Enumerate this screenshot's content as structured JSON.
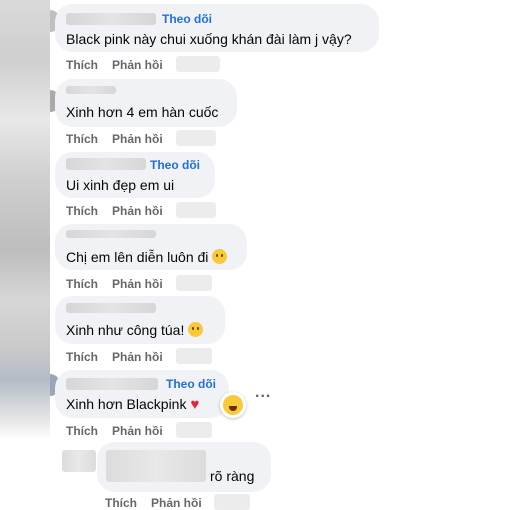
{
  "actions": {
    "like": "Thích",
    "reply": "Phản hồi"
  },
  "follow_label": "Theo dõi",
  "comments": [
    {
      "text": "Black pink này chui xuống khán đài làm j vậy?",
      "follow": true
    },
    {
      "text": "Xinh hơn 4 em hàn cuốc",
      "follow": false
    },
    {
      "text": "Ui xinh đẹp em ui",
      "follow": true
    },
    {
      "text": "Chị em lên diễn luôn đi",
      "follow": false,
      "emoji": "rolling-laughing-emoji"
    },
    {
      "text": "Xinh như công túa!",
      "follow": false,
      "emoji": "smiling-emoji"
    },
    {
      "text": "Xinh hơn Blackpink",
      "follow": true,
      "emoji": "red-heart",
      "reaction": "haha-reaction-icon",
      "more": "..."
    },
    {
      "text": "rõ ràng",
      "follow": false
    }
  ],
  "colors": {
    "bubble": "#f0f2f5",
    "follow": "#216fdb",
    "action": "#65676b",
    "text": "#050505"
  }
}
